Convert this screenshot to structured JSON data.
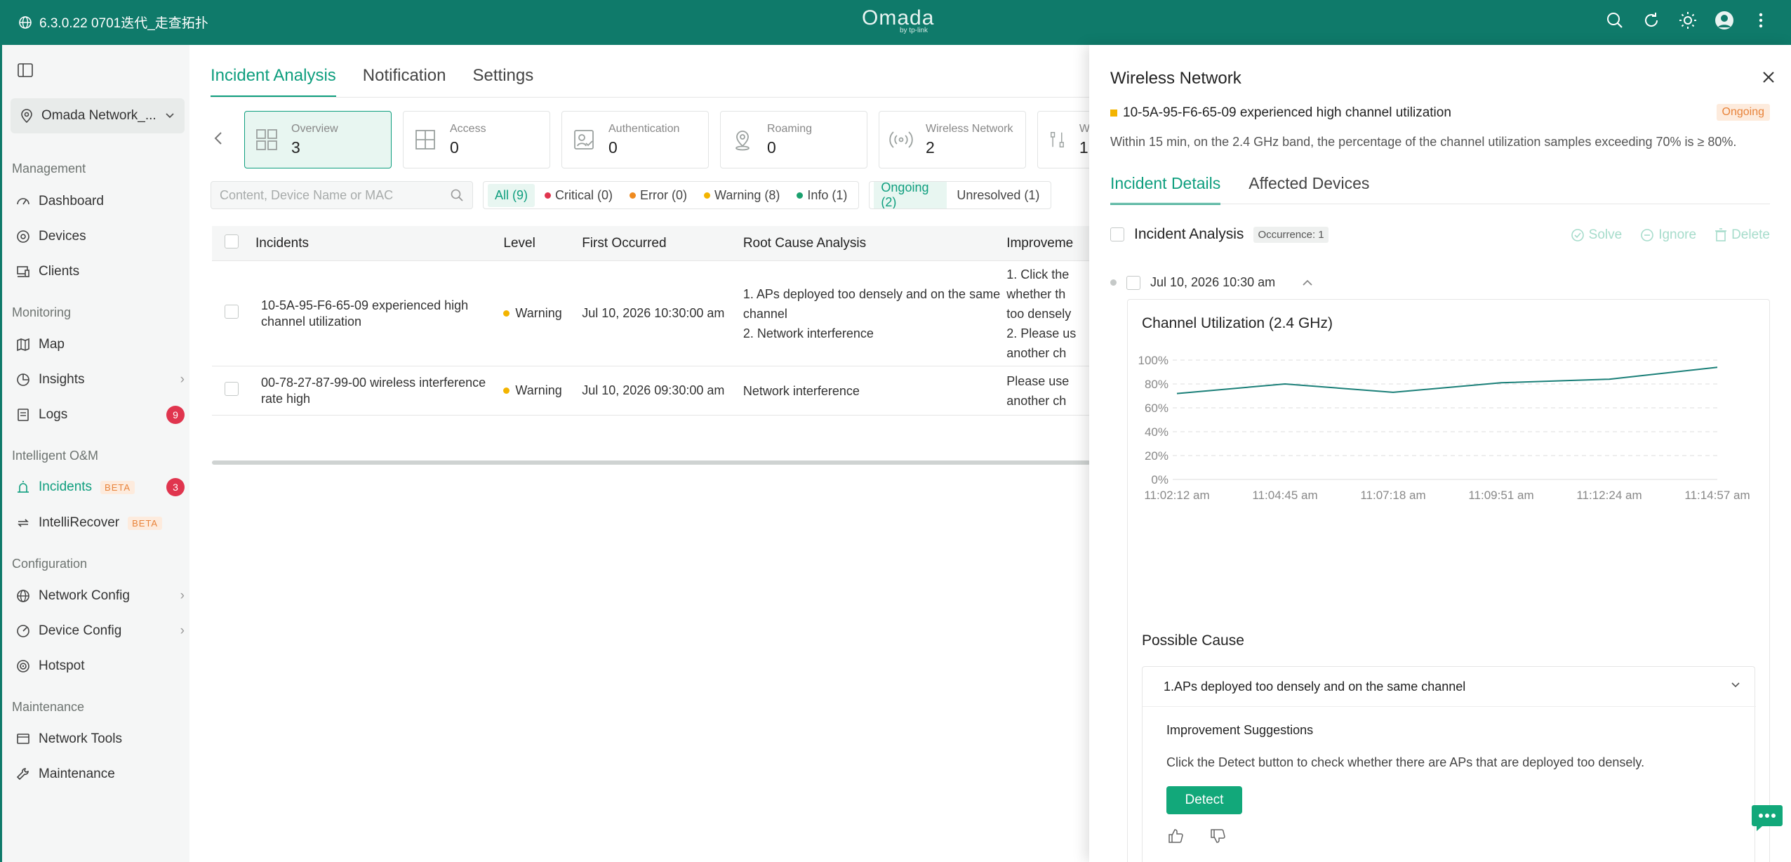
{
  "topbar": {
    "version": "6.3.0.22 0701迭代_走查拓扑",
    "logo": "Omada",
    "logo_sub": "by tp-link"
  },
  "sidebar": {
    "site": "Omada Network_...",
    "sections": {
      "management": "Management",
      "monitoring": "Monitoring",
      "intelligent": "Intelligent O&M",
      "configuration": "Configuration",
      "maintenance": "Maintenance"
    },
    "items": {
      "dashboard": "Dashboard",
      "devices": "Devices",
      "clients": "Clients",
      "map": "Map",
      "insights": "Insights",
      "logs": "Logs",
      "logs_badge": "9",
      "incidents": "Incidents",
      "incidents_badge": "3",
      "intellirecover": "IntelliRecover",
      "beta": "BETA",
      "network_config": "Network Config",
      "device_config": "Device Config",
      "hotspot": "Hotspot",
      "network_tools": "Network Tools",
      "maintenance": "Maintenance"
    }
  },
  "main": {
    "tabs": [
      "Incident Analysis",
      "Notification",
      "Settings"
    ],
    "cards": [
      {
        "label": "Overview",
        "value": "3"
      },
      {
        "label": "Access",
        "value": "0"
      },
      {
        "label": "Authentication",
        "value": "0"
      },
      {
        "label": "Roaming",
        "value": "0"
      },
      {
        "label": "Wireless Network",
        "value": "2"
      },
      {
        "label": "W",
        "value": "1"
      }
    ],
    "search_placeholder": "Content, Device Name or MAC",
    "level_filters": [
      "All (9)",
      "Critical (0)",
      "Error (0)",
      "Warning (8)",
      "Info (1)"
    ],
    "status_filters": [
      "Ongoing (2)",
      "Unresolved (1)"
    ],
    "columns": [
      "Incidents",
      "Level",
      "First Occurred",
      "Root Cause Analysis",
      "Improveme"
    ],
    "rows": [
      {
        "incident": "10-5A-95-F6-65-09 experienced high channel utilization",
        "level": "Warning",
        "first": "Jul 10, 2026 10:30:00 am",
        "cause1": "1. APs deployed too densely and on the same channel",
        "cause2": "2. Network interference",
        "imp1": "1. Click the",
        "imp2": "whether th",
        "imp3": "too densely",
        "imp4": "2. Please us",
        "imp5": "another ch"
      },
      {
        "incident": "00-78-27-87-99-00 wireless interference rate high",
        "level": "Warning",
        "first": "Jul 10, 2026 09:30:00 am",
        "cause1": "Network interference",
        "imp1": "Please use",
        "imp2": "another ch"
      }
    ]
  },
  "panel": {
    "title": "Wireless Network",
    "incident": "10-5A-95-F6-65-09 experienced high channel utilization",
    "status": "Ongoing",
    "description": "Within 15 min, on the 2.4 GHz band, the percentage of the channel utilization samples exceeding 70% is ≥ 80%.",
    "tabs": [
      "Incident Details",
      "Affected Devices"
    ],
    "analysis_label": "Incident Analysis",
    "occurrence": "Occurrence: 1",
    "actions": [
      "Solve",
      "Ignore",
      "Delete"
    ],
    "occurrence_time": "Jul 10, 2026 10:30 am",
    "chart_title": "Channel Utilization (2.4 GHz)",
    "possible_cause_title": "Possible Cause",
    "cause_item": "1.APs deployed too densely and on the same channel",
    "improvement_title": "Improvement Suggestions",
    "improvement_text": "Click the Detect button to check whether there are APs that are deployed too densely.",
    "detect_label": "Detect"
  },
  "colors": {
    "brand": "#0f7a6a",
    "accent": "#0e9e7e",
    "warning": "#f3b400",
    "critical": "#e0354e",
    "error": "#ef8a1f",
    "info": "#1aa06e"
  },
  "chart_data": {
    "type": "line",
    "title": "Channel Utilization (2.4 GHz)",
    "x": [
      "11:02:12 am",
      "11:04:45 am",
      "11:07:18 am",
      "11:09:51 am",
      "11:12:24 am",
      "11:14:57 am"
    ],
    "series": [
      {
        "values": [
          72,
          80,
          73,
          81,
          84,
          94
        ]
      }
    ],
    "yticks": [
      "0%",
      "20%",
      "40%",
      "60%",
      "80%",
      "100%"
    ],
    "ylim": [
      0,
      100
    ],
    "grid": true
  }
}
